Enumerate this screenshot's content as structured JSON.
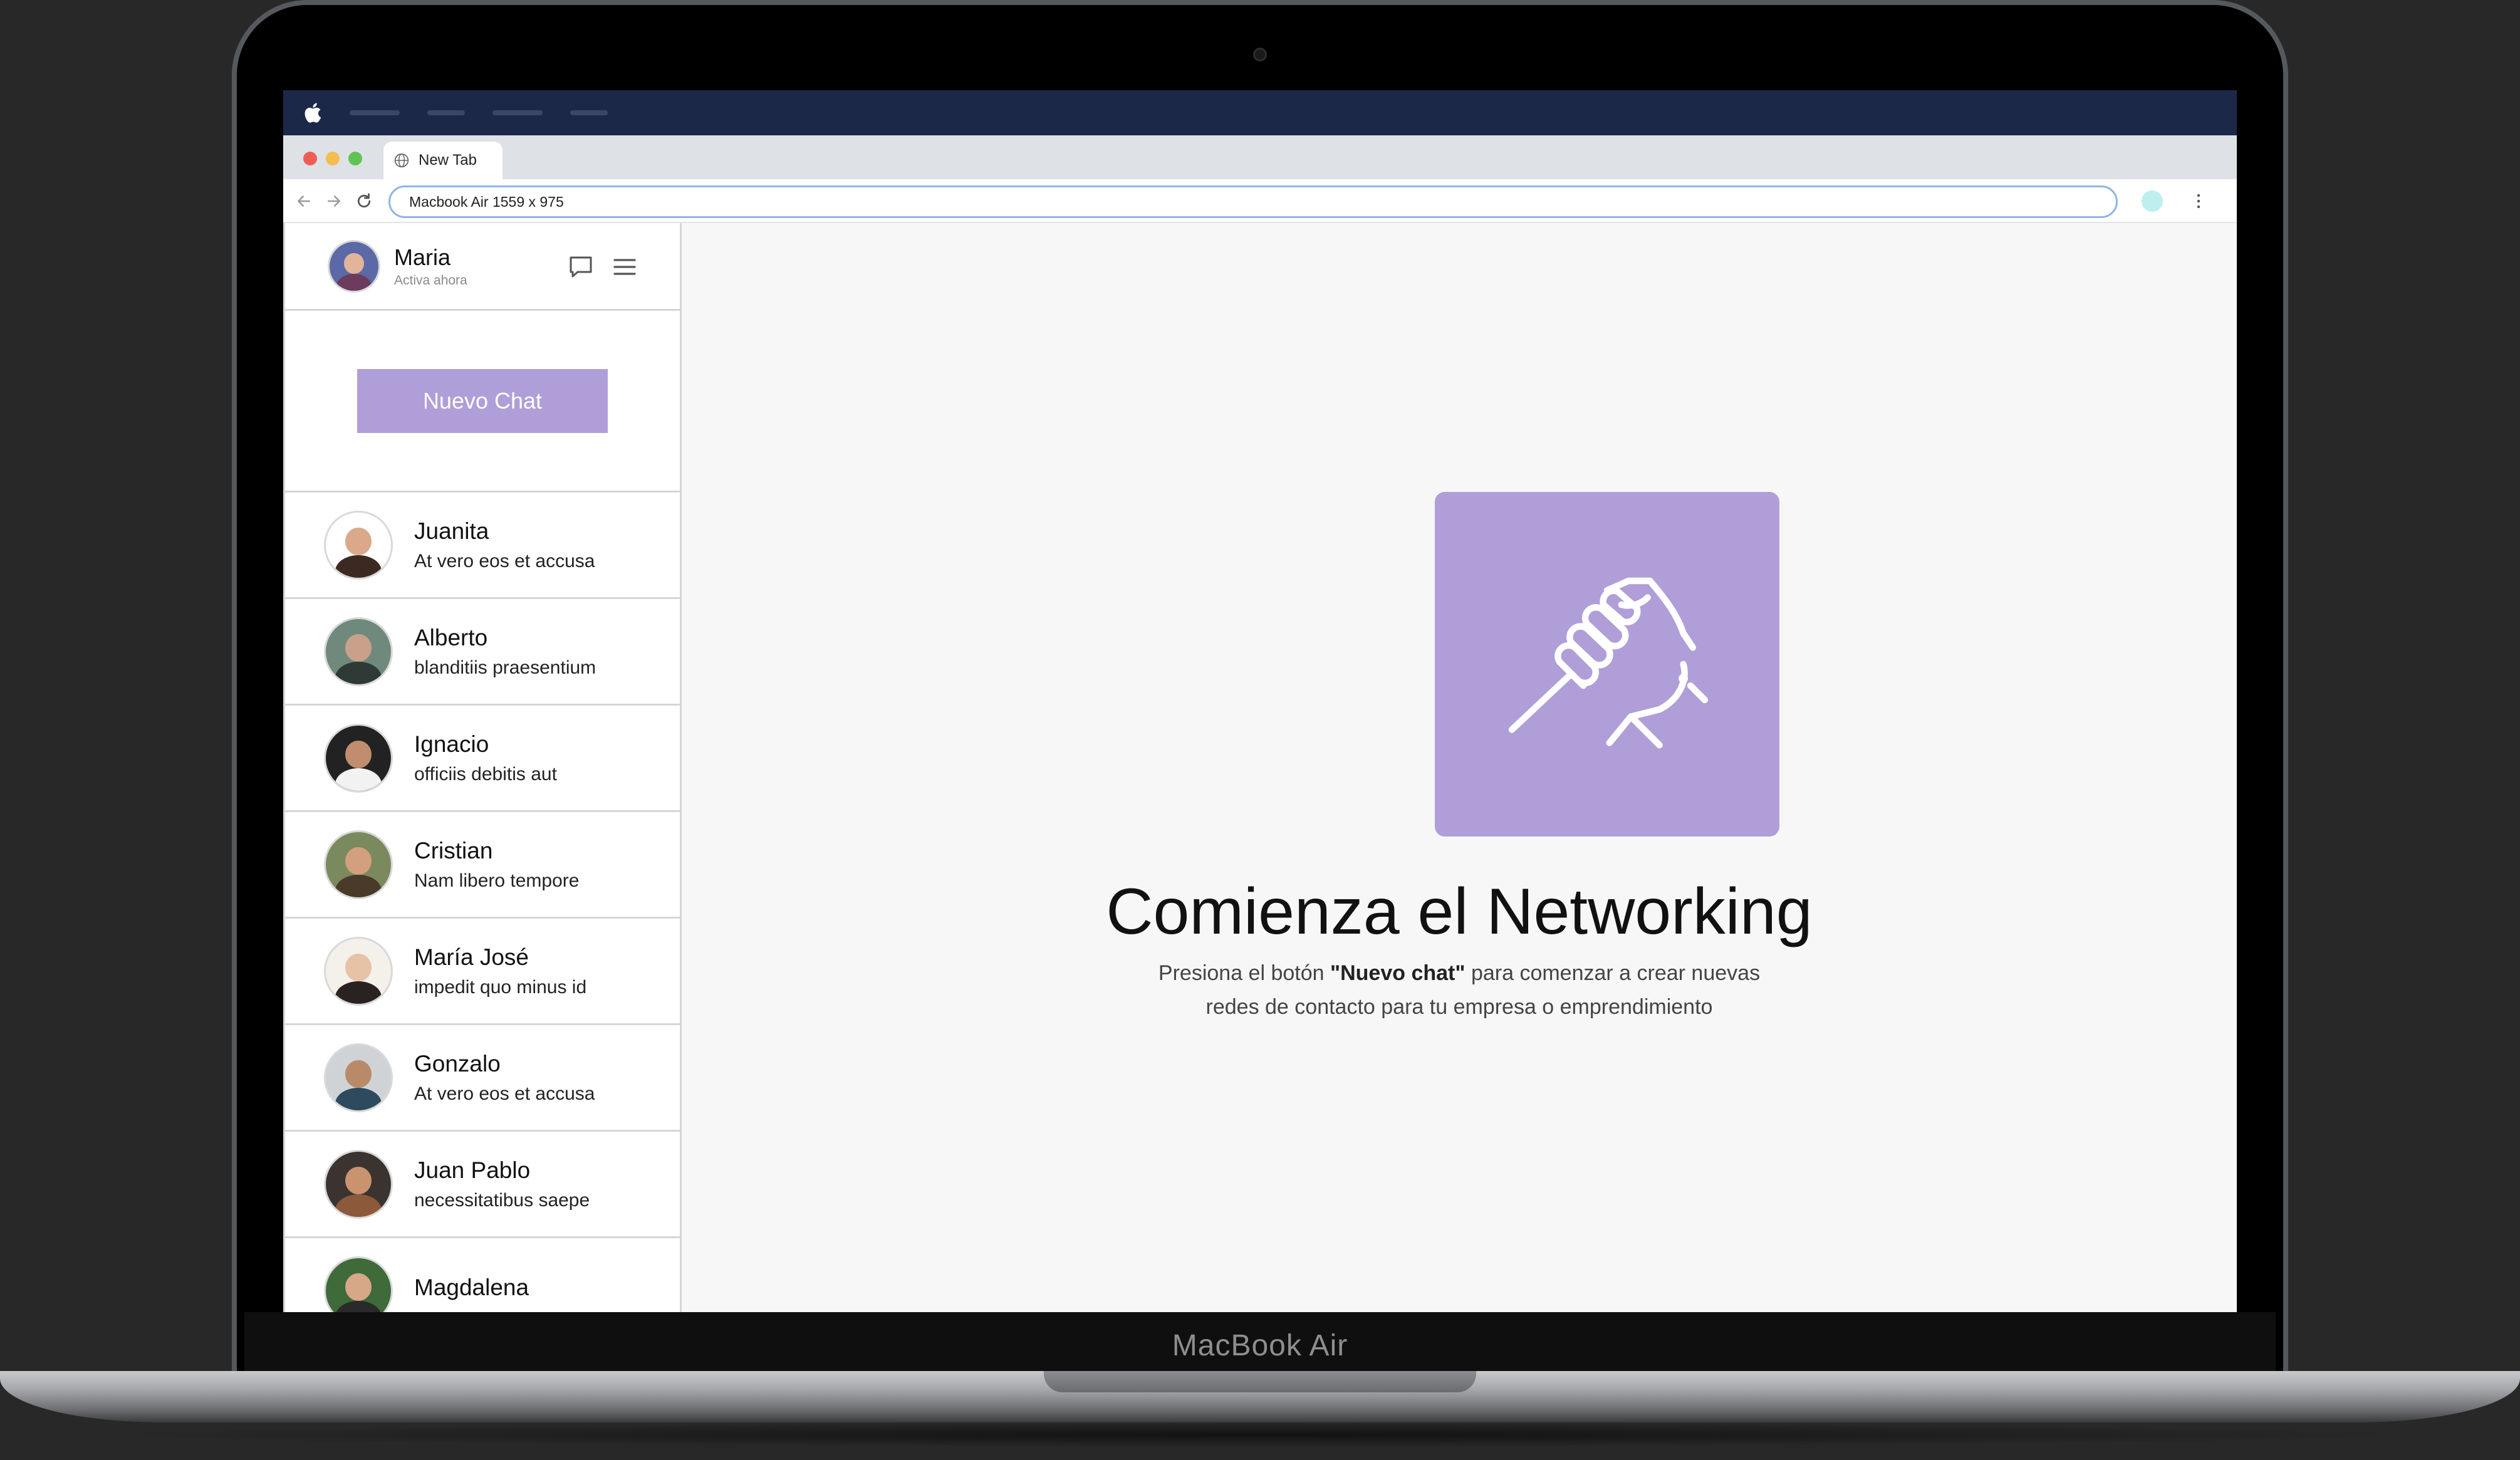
{
  "device": {
    "label": "MacBook Air"
  },
  "browser": {
    "tab_title": "New Tab",
    "url": "Macbook Air  1559 x 975"
  },
  "user": {
    "name": "Maria",
    "status": "Activa ahora"
  },
  "sidebar": {
    "new_chat_label": "Nuevo Chat",
    "contacts": [
      {
        "name": "Juanita",
        "message": "At vero eos et accusa"
      },
      {
        "name": "Alberto",
        "message": "blanditiis praesentium"
      },
      {
        "name": "Ignacio",
        "message": "officiis debitis aut"
      },
      {
        "name": "Cristian",
        "message": "Nam libero tempore"
      },
      {
        "name": "María José",
        "message": "impedit quo minus id"
      },
      {
        "name": "Gonzalo",
        "message": "At vero eos et accusa"
      },
      {
        "name": "Juan Pablo",
        "message": "necessitatibus saepe"
      },
      {
        "name": "Magdalena",
        "message": ""
      }
    ]
  },
  "main": {
    "title": "Comienza el Networking",
    "desc_before": "Presiona el botón ",
    "desc_bold": "\"Nuevo chat\"",
    "desc_after": " para comenzar a crear nuevas",
    "desc_line2": "redes de contacto para tu empresa o emprendimiento"
  },
  "colors": {
    "accent": "#b09ed8",
    "menubar": "#1c2848",
    "main_bg": "#f7f7f7"
  },
  "icons": {
    "apple": "apple-icon",
    "tab": "globe-icon",
    "header_chat": "chat-bubble-icon",
    "header_menu": "hamburger-menu-icon",
    "hero": "handshake-icon"
  }
}
